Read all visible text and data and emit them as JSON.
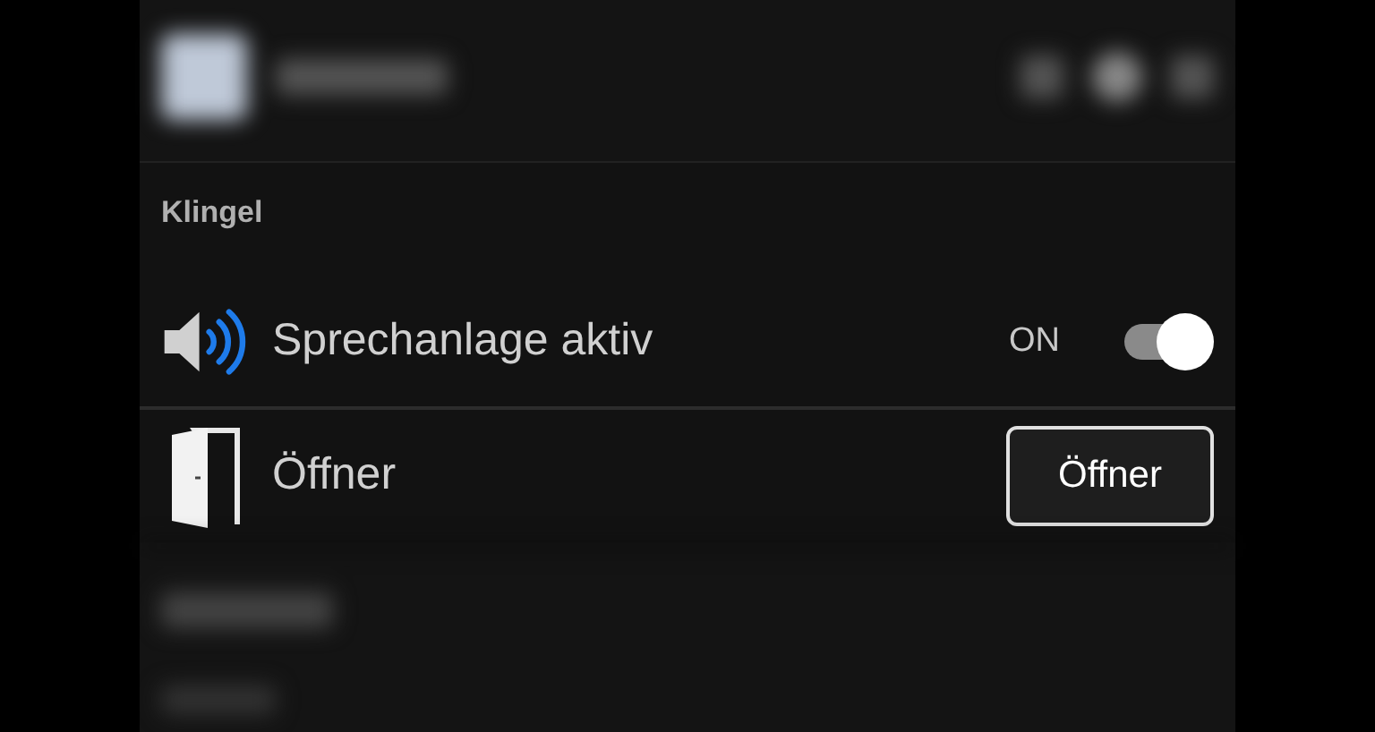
{
  "section": {
    "title": "Klingel",
    "rows": [
      {
        "kind": "toggle",
        "label": "Sprechanlage aktiv",
        "state_label": "ON",
        "on": true
      },
      {
        "kind": "button",
        "label": "Öffner",
        "button": "Öffner"
      }
    ]
  }
}
